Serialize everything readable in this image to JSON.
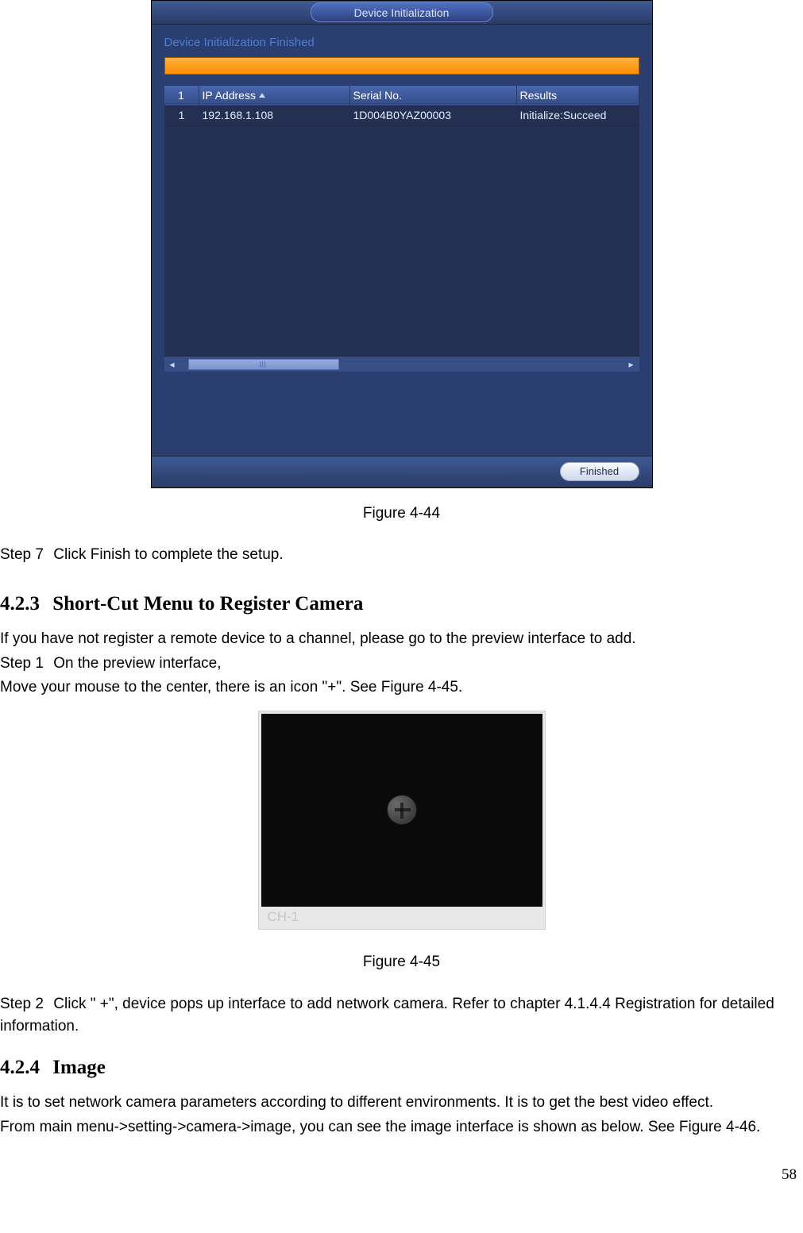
{
  "dialog": {
    "title": "Device Initialization",
    "progress_label": "Device Initialization Finished",
    "columns": {
      "idx": "1",
      "ip": "IP Address",
      "sn": "Serial No.",
      "res": "Results"
    },
    "row": {
      "idx": "1",
      "ip": "192.168.1.108",
      "sn": "1D004B0YAZ00003",
      "res": "Initialize:Succeed"
    },
    "scroll": {
      "left": "◂",
      "right": "▸"
    },
    "finished_btn": "Finished"
  },
  "fig1_caption": "Figure 4-44",
  "step7": {
    "num": "Step 7",
    "text": "Click Finish to complete the setup."
  },
  "sec423": {
    "no": "4.2.3",
    "title": "Short-Cut Menu to Register Camera"
  },
  "sec423_intro": "If you have not register a remote device to a channel, please go to the preview interface to add.",
  "step1": {
    "num": "Step 1",
    "text": "On the preview interface,",
    "text2": "Move your mouse to the center, there is an icon \"+\". See Figure 4-45."
  },
  "tile": {
    "ch": "CH-1"
  },
  "fig2_caption": "Figure 4-45",
  "step2": {
    "num": "Step 2",
    "text": "Click \" +\", device pops up interface to add network camera. Refer to chapter 4.1.4.4 Registration for detailed information."
  },
  "sec424": {
    "no": "4.2.4",
    "title": "Image"
  },
  "sec424_p1": "It is to set network camera parameters according to different environments. It is to get the best video effect.",
  "sec424_p2": "From main menu->setting->camera->image, you can see the image interface is shown as below. See Figure 4-46.",
  "page_num": "58"
}
